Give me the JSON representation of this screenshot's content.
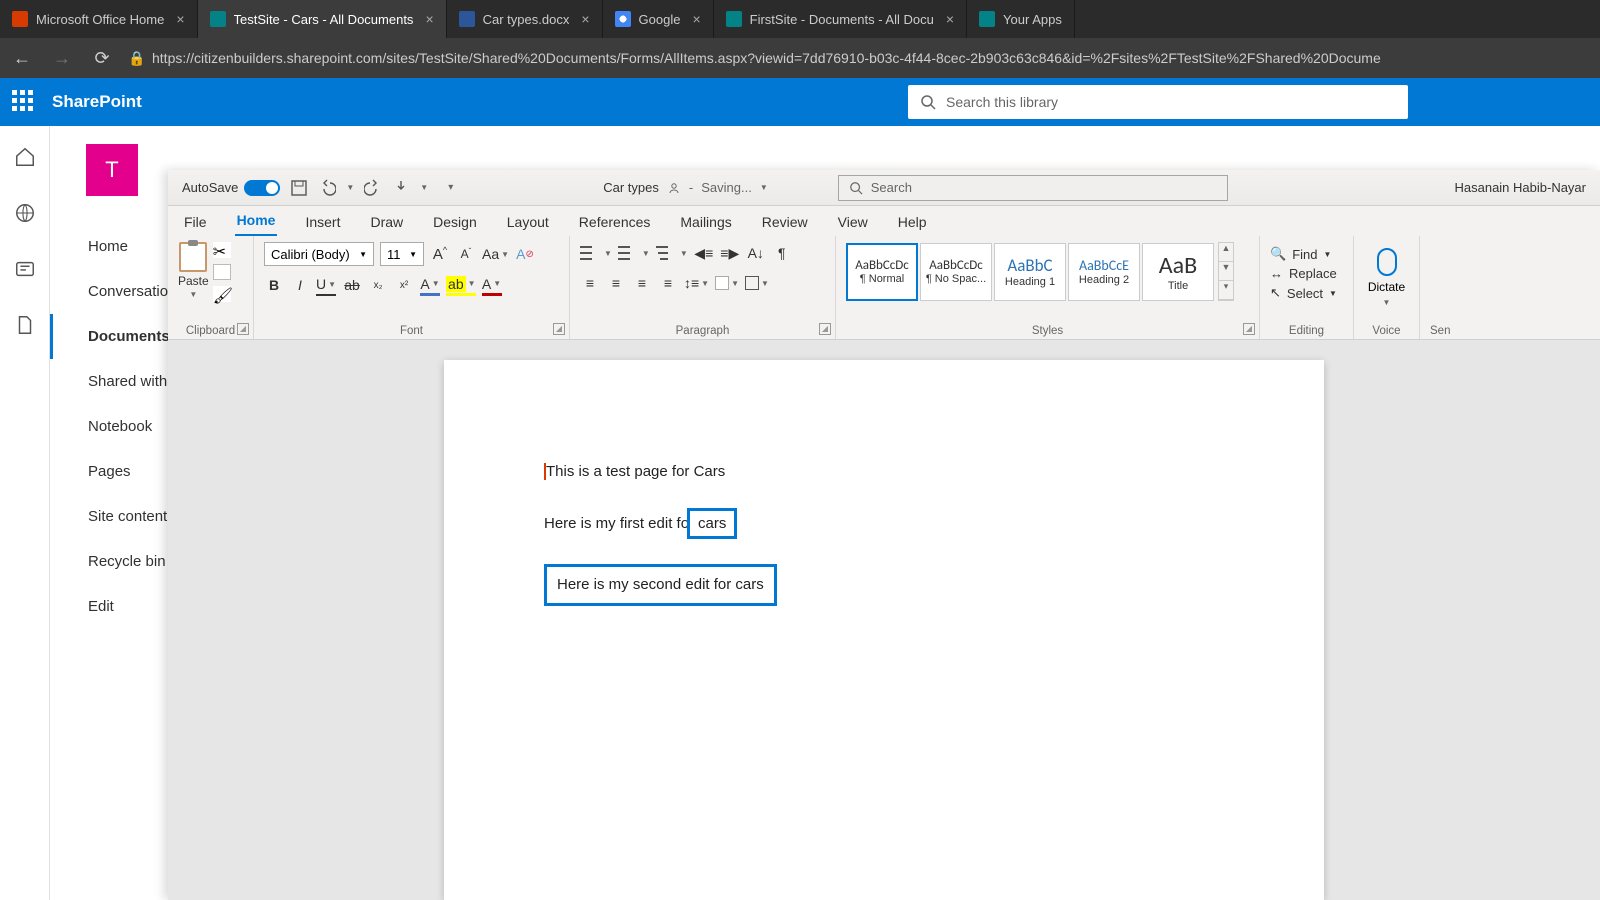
{
  "browser": {
    "tabs": [
      {
        "title": "Microsoft Office Home",
        "fav": "office"
      },
      {
        "title": "TestSite - Cars - All Documents",
        "fav": "sp",
        "active": true
      },
      {
        "title": "Car types.docx",
        "fav": "word"
      },
      {
        "title": "Google",
        "fav": "google"
      },
      {
        "title": "FirstSite - Documents - All Docu",
        "fav": "sp"
      },
      {
        "title": "Your Apps",
        "fav": "sp"
      }
    ],
    "url": "https://citizenbuilders.sharepoint.com/sites/TestSite/Shared%20Documents/Forms/AllItems.aspx?viewid=7dd76910-b03c-4f44-8cec-2b903c63c846&id=%2Fsites%2FTestSite%2FShared%20Docume"
  },
  "sharepoint": {
    "product": "SharePoint",
    "search_placeholder": "Search this library",
    "site_initial": "T",
    "nav": [
      "Home",
      "Conversation",
      "Documents",
      "Shared with",
      "Notebook",
      "Pages",
      "Site content",
      "Recycle bin",
      "Edit"
    ],
    "nav_selected": "Documents"
  },
  "word": {
    "autosave_label": "AutoSave",
    "autosave_state": "On",
    "doc_name": "Car types",
    "save_status": "Saving...",
    "search_placeholder": "Search",
    "user": "Hasanain Habib-Nayar",
    "tabs": [
      "File",
      "Home",
      "Insert",
      "Draw",
      "Design",
      "Layout",
      "References",
      "Mailings",
      "Review",
      "View",
      "Help"
    ],
    "active_tab": "Home",
    "font_name": "Calibri (Body)",
    "font_size": "11",
    "groups": {
      "clipboard": "Clipboard",
      "font": "Font",
      "paragraph": "Paragraph",
      "styles": "Styles",
      "editing": "Editing",
      "voice": "Voice",
      "sens": "Sen"
    },
    "paste_label": "Paste",
    "styles": [
      {
        "name": "¶ Normal",
        "preview": "AaBbCcDc",
        "size": "13",
        "selected": true
      },
      {
        "name": "¶ No Spac...",
        "preview": "AaBbCcDc",
        "size": "13"
      },
      {
        "name": "Heading 1",
        "preview": "AaBbC",
        "size": "17",
        "color": "#2e74b5"
      },
      {
        "name": "Heading 2",
        "preview": "AaBbCcE",
        "size": "14",
        "color": "#2e74b5"
      },
      {
        "name": "Title",
        "preview": "AaB",
        "size": "24"
      }
    ],
    "editing": {
      "find": "Find",
      "replace": "Replace",
      "select": "Select"
    },
    "dictate": "Dictate"
  },
  "document": {
    "line1": "This is a test page for Cars",
    "line2_pre": "Here is my first edit fo",
    "line2_box": "cars",
    "line3": "Here is my second edit for cars"
  }
}
